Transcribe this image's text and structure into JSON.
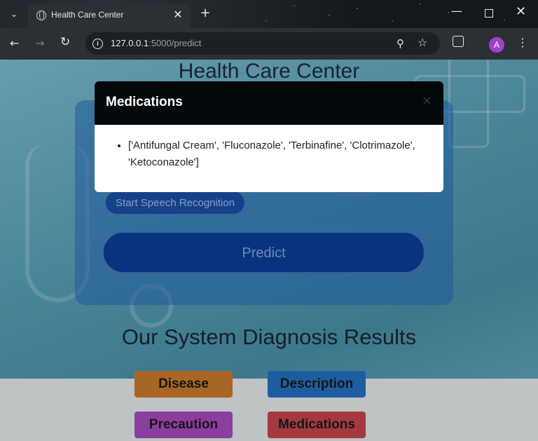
{
  "browser": {
    "tab_title": "Health Care Center",
    "url_host": "127.0.0.1",
    "url_path": ":5000/predict",
    "avatar_letter": "A"
  },
  "page": {
    "title": "Health Care Center",
    "speech_button": "Start Speech Recognition",
    "predict_button": "Predict",
    "results_title": "Our System Diagnosis Results",
    "result_buttons": {
      "disease": "Disease",
      "description": "Description",
      "precaution": "Precaution",
      "medications": "Medications"
    }
  },
  "modal": {
    "title": "Medications",
    "items": [
      "['Antifungal Cream', 'Fluconazole', 'Terbinafine', 'Clotrimazole', 'Ketoconazole']"
    ]
  },
  "colors": {
    "disease": "#cf7c2b",
    "description": "#2672c5",
    "precaution": "#ab4cc1",
    "medications": "#c9474f"
  }
}
